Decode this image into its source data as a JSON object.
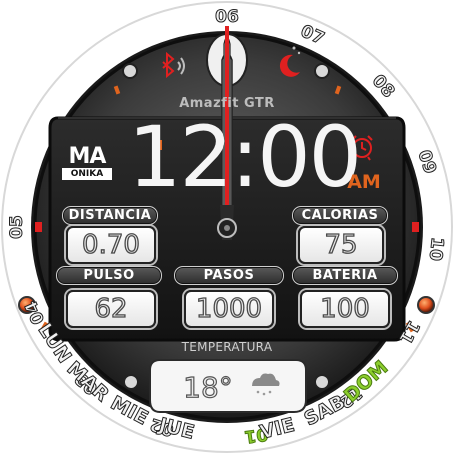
{
  "bezel": {
    "hours": [
      "06",
      "07",
      "08",
      "09",
      "10",
      "11",
      "12",
      "01",
      "02",
      "03",
      "04",
      "05"
    ],
    "days": [
      "LUN",
      "MAR",
      "MIE",
      "JUE",
      "VIE",
      "SAB",
      "DOM"
    ],
    "highlight_hour": "01",
    "highlight_day": "DOM"
  },
  "header": {
    "brand": "Amazfit GTR",
    "bluetooth_icon": "bluetooth-icon",
    "night_icon": "moon-stars-icon"
  },
  "logo": {
    "main": "MA",
    "sub": "ONIKA"
  },
  "time": {
    "digital": "12:00",
    "ampm": "AM",
    "alarm_icon": "alarm-clock-icon"
  },
  "stats": {
    "distance": {
      "label": "DISTANCIA",
      "value": "0.70"
    },
    "calories": {
      "label": "CALORIAS",
      "value": "75"
    },
    "pulse": {
      "label": "PULSO",
      "value": "62"
    },
    "steps": {
      "label": "PASOS",
      "value": "1000"
    },
    "battery": {
      "label": "BATERIA",
      "value": "100"
    }
  },
  "weather": {
    "label": "TEMPERATURA",
    "value": "18°",
    "icon": "cloud-rain-icon"
  },
  "colors": {
    "accent_red": "#e02020",
    "accent_orange": "#e0641e",
    "highlight_green": "#8ccf2c",
    "case_gray": "#3a3a3a"
  }
}
